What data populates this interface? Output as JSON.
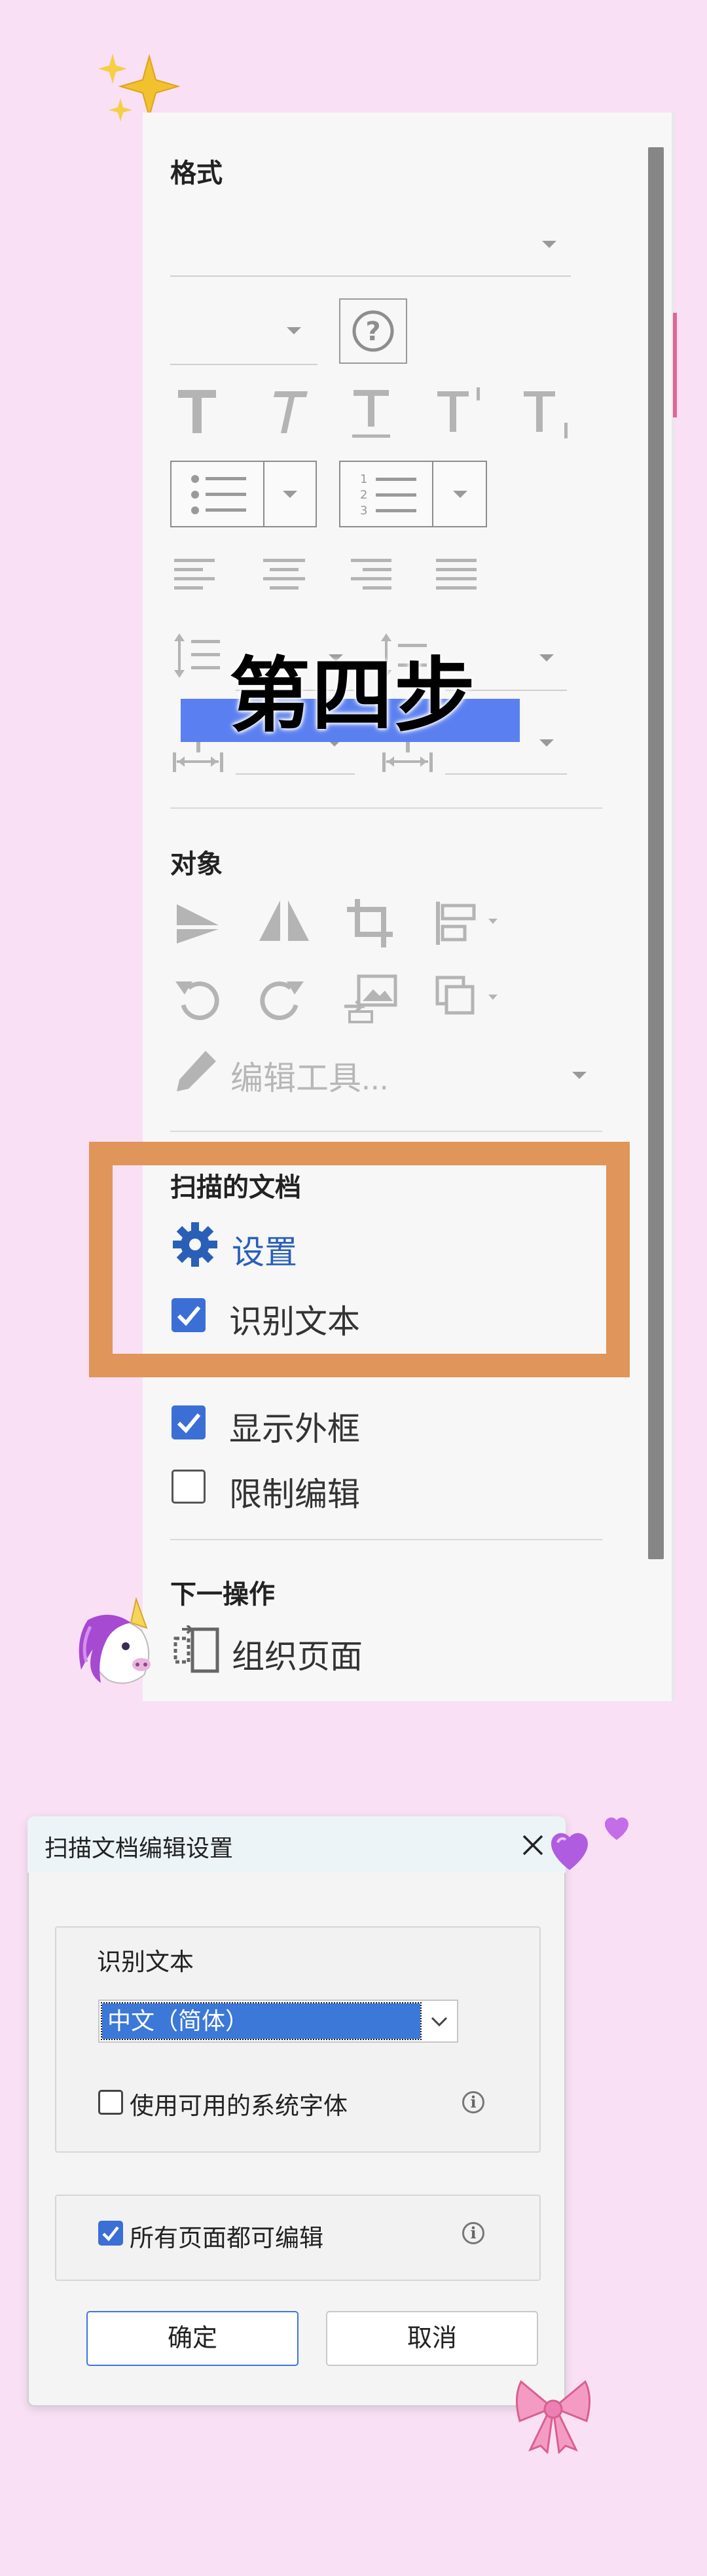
{
  "sections": {
    "format": {
      "title": "格式"
    },
    "object": {
      "title": "对象",
      "edit_tools_label": "编辑工具..."
    },
    "scanned": {
      "title": "扫描的文档",
      "settings_label": "设置",
      "recognize_text_label": "识别文本",
      "show_frame_label": "显示外框",
      "restrict_edit_label": "限制编辑"
    },
    "next": {
      "title": "下一操作",
      "organize_pages_label": "组织页面"
    }
  },
  "overlay": {
    "step_label": "第四步"
  },
  "dialog": {
    "title": "扫描文档编辑设置",
    "recognize_group_label": "识别文本",
    "language_value": "中文（简体）",
    "use_system_fonts_label": "使用可用的系统字体",
    "all_pages_editable_label": "所有页面都可编辑",
    "ok_label": "确定",
    "cancel_label": "取消"
  },
  "decorations": [
    "sparkles",
    "unicorn",
    "purple-hearts",
    "pink-ribbon"
  ],
  "colors": {
    "highlight_box": "#e0955a",
    "checkbox_accent": "#3b6fd6",
    "step_bar": "#5a7ff0",
    "background": "#f9e0f5"
  }
}
